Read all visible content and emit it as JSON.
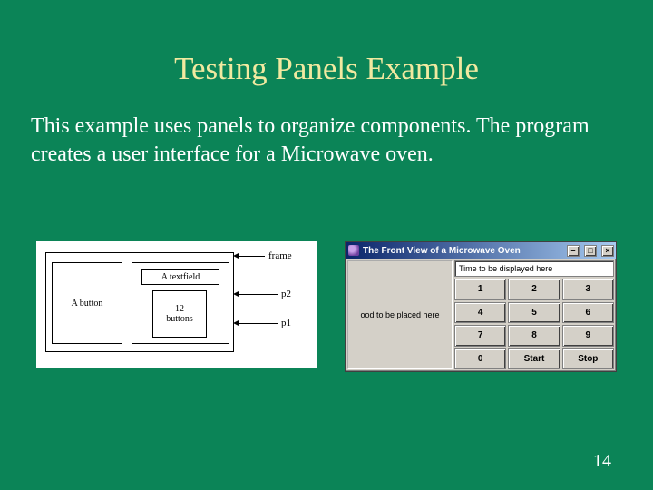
{
  "title": "Testing Panels Example",
  "body_text": "This example uses panels to organize components. The program creates a user interface for a Microwave oven.",
  "page_number": "14",
  "diagram": {
    "left_box": "A button",
    "tf_box": "A textfield",
    "btns_box_line1": "12",
    "btns_box_line2": "buttons",
    "label_frame": "frame",
    "label_p2": "p2",
    "label_p1": "p1"
  },
  "window": {
    "title": "The Front View of a Microwave Oven",
    "minimize_glyph": "–",
    "maximize_glyph": "□",
    "close_glyph": "×",
    "food_panel_text": "ood to be placed here",
    "time_field_text": "Time to be displayed here",
    "keypad": [
      "1",
      "2",
      "3",
      "4",
      "5",
      "6",
      "7",
      "8",
      "9",
      "0",
      "Start",
      "Stop"
    ]
  }
}
